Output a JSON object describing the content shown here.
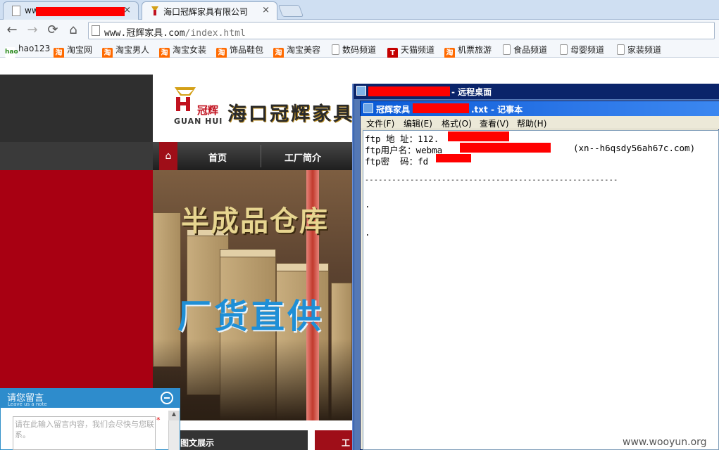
{
  "browser": {
    "tabs": [
      {
        "title": "ww",
        "active": false
      },
      {
        "title": "海口冠辉家具有限公司",
        "active": true
      }
    ],
    "close_glyph": "×",
    "nav": {
      "back": "←",
      "forward": "→",
      "reload": "⟳",
      "home": "⌂"
    },
    "address": {
      "host": "www.冠辉家具.com",
      "path": "/index.html"
    },
    "bookmarks": [
      {
        "label": "hao123",
        "icon": "hao123-icon"
      },
      {
        "label": "淘宝网",
        "icon": "taobao-icon"
      },
      {
        "label": "淘宝男人",
        "icon": "taobao-icon"
      },
      {
        "label": "淘宝女装",
        "icon": "taobao-icon"
      },
      {
        "label": "饰品鞋包",
        "icon": "taobao-icon"
      },
      {
        "label": "淘宝美容",
        "icon": "taobao-icon"
      },
      {
        "label": "数码频道",
        "icon": "page-icon"
      },
      {
        "label": "天猫频道",
        "icon": "tmall-icon"
      },
      {
        "label": "机票旅游",
        "icon": "taobao-icon"
      },
      {
        "label": "食品频道",
        "icon": "page-icon"
      },
      {
        "label": "母婴频道",
        "icon": "page-icon"
      },
      {
        "label": "家装频道",
        "icon": "page-icon"
      }
    ],
    "icon_glyphs": {
      "taobao": "淘",
      "tmall": "T",
      "hao123": "hao"
    }
  },
  "site": {
    "logo_cn": "冠辉",
    "logo_en": "GUAN HUI",
    "title": "海口冠辉家具",
    "nav_home_glyph": "⌂",
    "nav": [
      "首页",
      "工厂简介"
    ],
    "banner_line1": "半成品仓库",
    "banner_line2": "厂货直供",
    "gallery_label": "图文展示",
    "gallery_label2": "工"
  },
  "message_widget": {
    "title": "请您留言",
    "subtitle": "Leave us a note",
    "placeholder": "请在此输入留言内容，我们会尽快与您联系。",
    "required_mark": "*",
    "scroll_up_glyph": "▲"
  },
  "remote_desktop": {
    "title": "- 远程桌面"
  },
  "notepad": {
    "title_left": "冠辉家具",
    "title_right": ".txt - 记事本",
    "menus": [
      "文件(F)",
      "编辑(E)",
      "格式(O)",
      "查看(V)",
      "帮助(H)"
    ],
    "lines": [
      "ftp 地 址：112.",
      "ftp用户名：webma",
      "ftp密  码：fd",
      "",
      "--------------------------------------------------------",
      ".",
      "",
      "."
    ],
    "domain_note": "(xn--h6qsdy56ah67c.com)"
  },
  "watermark": "www.wooyun.org",
  "colors": {
    "redaction": "#ff0000",
    "site_red": "#a80012",
    "chrome_blue": "#cfdff2",
    "xp_title_blue": "#0a5ad6",
    "widget_blue": "#2e8ccc"
  }
}
